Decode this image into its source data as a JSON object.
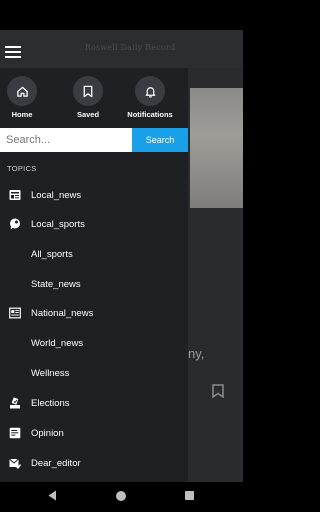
{
  "header": {
    "masthead": "Roswell Daily Record"
  },
  "shortcuts": [
    {
      "label": "Home",
      "icon": "home-icon"
    },
    {
      "label": "Saved",
      "icon": "bookmark-icon"
    },
    {
      "label": "Notifications",
      "icon": "bell-icon"
    }
  ],
  "search": {
    "placeholder": "Search...",
    "button_label": "Search"
  },
  "topics_heading": "TOPICS",
  "topics": [
    {
      "label": "Local_news",
      "icon": "newspaper-icon"
    },
    {
      "label": "Local_sports",
      "icon": "ball-icon"
    },
    {
      "label": "All_sports",
      "icon": ""
    },
    {
      "label": "State_news",
      "icon": ""
    },
    {
      "label": "National_news",
      "icon": "article-icon"
    },
    {
      "label": "World_news",
      "icon": ""
    },
    {
      "label": "Wellness",
      "icon": ""
    },
    {
      "label": "Elections",
      "icon": "ballot-icon"
    },
    {
      "label": "Opinion",
      "icon": "opinion-icon"
    },
    {
      "label": "Dear_editor",
      "icon": "mail-icon"
    }
  ],
  "background_article": {
    "partial_text": "ny,"
  },
  "colors": {
    "accent": "#1aa0e8",
    "drawer": "#1f2024",
    "appbar": "#2b2d31"
  }
}
